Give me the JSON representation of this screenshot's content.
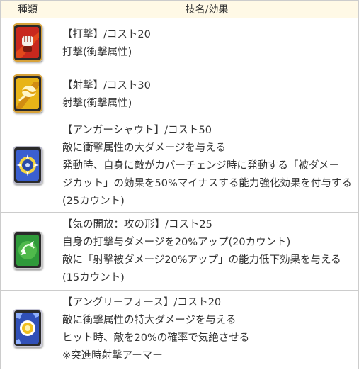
{
  "header": {
    "type_label": "種類",
    "name_label": "技名/効果"
  },
  "rows": [
    {
      "icon": "fist-card-icon",
      "accent": "#c8281e",
      "lines": [
        "【打撃】/コスト20",
        "打撃(衝撃属性)"
      ]
    },
    {
      "icon": "shot-card-icon",
      "accent": "#e8b418",
      "lines": [
        "【射撃】/コスト30",
        "射撃(衝撃属性)"
      ]
    },
    {
      "icon": "burst-card-icon",
      "accent": "#3a5fd0",
      "lines": [
        "【アンガーシャウト】/コスト50",
        "敵に衝撃属性の大ダメージを与える",
        "発動時、自身に敵がカバーチェンジ時に発動する「被ダメー",
        "ジカット」の効果を50%マイナスする能力強化効果を付与する",
        "(25カウント)"
      ]
    },
    {
      "icon": "spirit-card-icon",
      "accent": "#2f9a3a",
      "lines": [
        "【気の開放：攻の形】/コスト25",
        "自身の打撃与ダメージを20%アップ(20カウント)",
        "敵に「射撃被ダメージ20%アップ」の能力低下効果を与える",
        "(15カウント)"
      ]
    },
    {
      "icon": "sunburst-card-icon",
      "accent": "#f0c020",
      "lines": [
        "【アングリーフォース】/コスト20",
        "敵に衝撃属性の特大ダメージを与える",
        "ヒット時、敵を20%の確率で気絶させる",
        "※突進時射撃アーマー"
      ]
    }
  ]
}
